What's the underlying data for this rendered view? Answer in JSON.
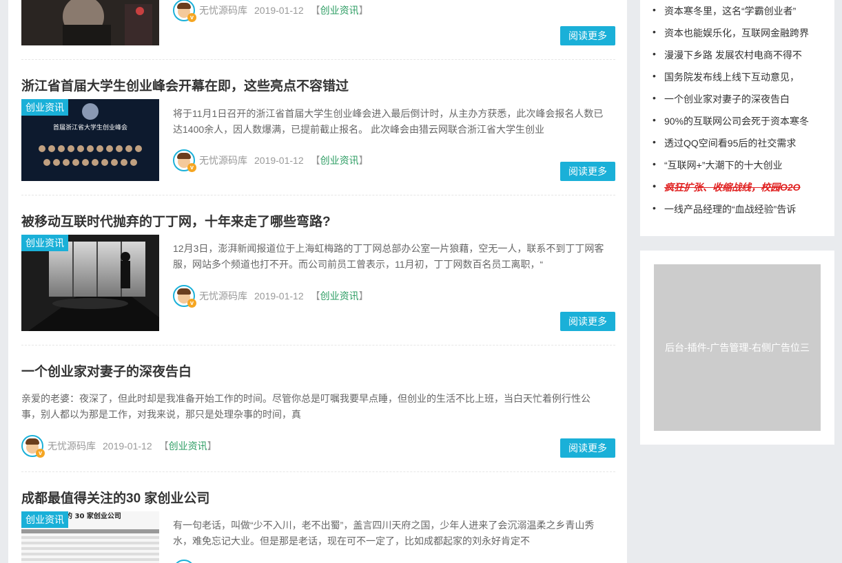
{
  "articles": [
    {
      "title": "",
      "excerpt": "",
      "author": "无忧源码库",
      "date": "2019-01-12",
      "category_prefix": "【",
      "category": "创业资讯",
      "category_suffix": "】",
      "read_more": "阅读更多"
    },
    {
      "title": "浙江省首届大学生创业峰会开幕在即，这些亮点不容错过",
      "tag": "创业资讯",
      "excerpt": "将于11月1日召开的浙江省首届大学生创业峰会进入最后倒计时，从主办方获悉，此次峰会报名人数已达1400余人，因人数爆满，已提前截止报名。 此次峰会由猎云网联合浙江省大学生创业",
      "thumb_text": "首届浙江省大学生创业峰会",
      "author": "无忧源码库",
      "date": "2019-01-12",
      "category_prefix": "【",
      "category": "创业资讯",
      "category_suffix": "】",
      "read_more": "阅读更多"
    },
    {
      "title": "被移动互联时代抛弃的丁丁网，十年来走了哪些弯路?",
      "tag": "创业资讯",
      "excerpt": "12月3日，澎湃新闻报道位于上海虹梅路的丁丁网总部办公室一片狼藉，空无一人，联系不到丁丁网客服，网站多个频道也打不开。而公司前员工曾表示，11月初，丁丁网数百名员工离职，“",
      "author": "无忧源码库",
      "date": "2019-01-12",
      "category_prefix": "【",
      "category": "创业资讯",
      "category_suffix": "】",
      "read_more": "阅读更多"
    },
    {
      "title": "一个创业家对妻子的深夜告白",
      "excerpt": "亲爱的老婆：夜深了，但此时却是我准备开始工作的时间。尽管你总是叮嘱我要早点睡，但创业的生活不比上班，当白天忙着例行性公事，别人都以为那是工作，对我来说，那只是处理杂事的时间，真",
      "author": "无忧源码库",
      "date": "2019-01-12",
      "category_prefix": "【",
      "category": "创业资讯",
      "category_suffix": "】",
      "read_more": "阅读更多"
    },
    {
      "title": "成都最值得关注的30 家创业公司",
      "tag": "创业资讯",
      "thumb_text": "得关注的 30 家创业公司",
      "excerpt": "有一句老话，叫做“少不入川，老不出蜀”，盖言四川天府之国，少年人进来了会沉溺温柔之乡青山秀水，难免忘记大业。但是那是老话，现在可不一定了，比如成都起家的刘永好肯定不"
    }
  ],
  "sidebar": {
    "items": [
      "资本寒冬里，这名“学霸创业者”",
      "资本也能娱乐化，互联网金融跨界",
      "漫漫下乡路 发展农村电商不得不",
      "国务院发布线上线下互动意见，",
      "一个创业家对妻子的深夜告白",
      "90%的互联网公司会死于资本寒冬",
      "透过QQ空间看95后的社交需求",
      "“互联网+”大潮下的十大创业",
      "疯狂扩张、收缩战线，校园O2O",
      "一线产品经理的“血战经验”告诉"
    ],
    "ad_text": "后台-插件-广告管理-右侧广告位三"
  },
  "colors": {
    "accent": "#1ab0d8",
    "category": "#2b9c62",
    "hot": "#e02020",
    "page_bg": "#e9ebee"
  }
}
